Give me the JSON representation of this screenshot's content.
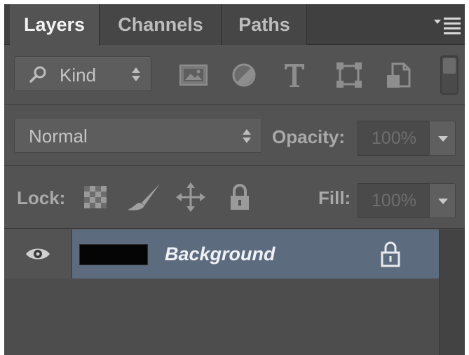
{
  "tabs": [
    {
      "label": "Layers",
      "active": true
    },
    {
      "label": "Channels",
      "active": false
    },
    {
      "label": "Paths",
      "active": false
    }
  ],
  "filter": {
    "kind_label": "Kind",
    "icons": [
      "pixel-layer-filter-icon",
      "adjustment-layer-filter-icon",
      "type-layer-filter-icon",
      "shape-layer-filter-icon",
      "smart-object-filter-icon"
    ]
  },
  "blend": {
    "mode": "Normal",
    "opacity_label": "Opacity:",
    "opacity_value": "100%"
  },
  "lock": {
    "label": "Lock:",
    "icons": [
      "lock-transparent-pixels-icon",
      "lock-image-pixels-icon",
      "lock-position-icon",
      "lock-all-icon"
    ],
    "fill_label": "Fill:",
    "fill_value": "100%"
  },
  "layers": [
    {
      "name": "Background",
      "visible": true,
      "locked": true,
      "selected": true,
      "thumbnail_color": "#050505"
    }
  ],
  "colors": {
    "panel_bg": "#535353",
    "selection": "#5d6b7f",
    "text": "#c9c9c9"
  }
}
